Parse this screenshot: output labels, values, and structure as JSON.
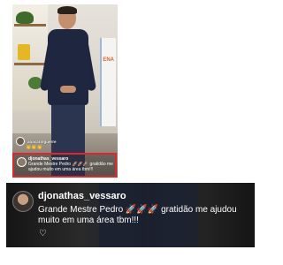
{
  "live": {
    "comments": [
      {
        "user": "anacarolguerre",
        "text": "👏👏👏"
      },
      {
        "user": "pchelalin__",
        "text": ""
      }
    ],
    "highlighted_comment": {
      "user": "djonathas_vessaro",
      "text": "Grande Mestre Pedro 🚀🚀🚀 gratidão me ajudou muito em uma área tbm!!!"
    },
    "banner_text": "ENA"
  },
  "zoomed_comment": {
    "user": "djonathas_vessaro",
    "text": "Grande Mestre Pedro 🚀🚀🚀 gratidão me ajudou muito em uma área tbm!!!",
    "heart_icon": "heart-icon"
  },
  "colors": {
    "highlight_border": "#e0262c",
    "zoom_background": "#1d1d1d"
  }
}
